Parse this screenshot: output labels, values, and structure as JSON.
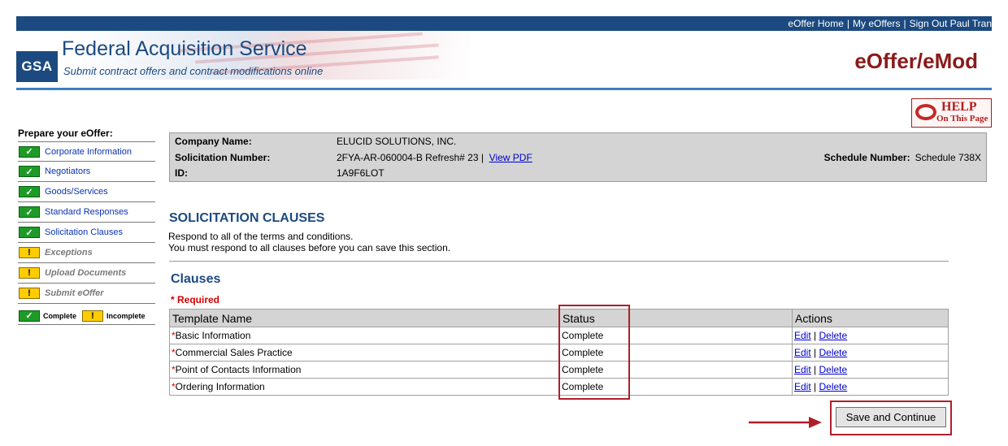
{
  "topnav": {
    "home": "eOffer Home",
    "myoffers": "My eOffers",
    "signout": "Sign Out Paul Tran",
    "sep": "|"
  },
  "header": {
    "logo": "GSA",
    "title": "Federal Acquisition Service",
    "subtitle": "Submit contract offers and contract modifications online",
    "brand": "eOffer/eMod"
  },
  "help": {
    "line1": "HELP",
    "line2": "On This Page"
  },
  "leftnav": {
    "title": "Prepare your eOffer:",
    "items": [
      {
        "label": "Corporate Information",
        "status": "complete"
      },
      {
        "label": "Negotiators",
        "status": "complete"
      },
      {
        "label": "Goods/Services",
        "status": "complete"
      },
      {
        "label": "Standard Responses",
        "status": "complete"
      },
      {
        "label": "Solicitation Clauses",
        "status": "complete"
      },
      {
        "label": "Exceptions",
        "status": "incomplete"
      },
      {
        "label": "Upload Documents",
        "status": "incomplete"
      },
      {
        "label": "Submit eOffer",
        "status": "incomplete"
      }
    ],
    "legend_complete": "Complete",
    "legend_incomplete": "Incomplete",
    "check_glyph": "✓",
    "warn_glyph": "!"
  },
  "info": {
    "company_label": "Company Name:",
    "company_value": "ELUCID SOLUTIONS, INC.",
    "solicitation_label": "Solicitation Number:",
    "solicitation_value": "2FYA-AR-060004-B Refresh# 23 |",
    "view_pdf": "View PDF",
    "id_label": "ID:",
    "id_value": "1A9F6LOT",
    "schedule_label": "Schedule Number:",
    "schedule_value": "Schedule 738X"
  },
  "section": {
    "title": "SOLICITATION CLAUSES",
    "desc1": "Respond to all of the terms and conditions.",
    "desc2": "You must respond to all clauses before you can save this section.",
    "clauses_title": "Clauses",
    "required": "* Required"
  },
  "table": {
    "headers": [
      "Template Name",
      "Status",
      "Actions"
    ],
    "rows": [
      {
        "name": "Basic Information",
        "status": "Complete",
        "edit": "Edit",
        "delete": "Delete"
      },
      {
        "name": "Commercial Sales Practice",
        "status": "Complete",
        "edit": "Edit",
        "delete": "Delete"
      },
      {
        "name": "Point of Contacts Information",
        "status": "Complete",
        "edit": "Edit",
        "delete": "Delete"
      },
      {
        "name": "Ordering Information",
        "status": "Complete",
        "edit": "Edit",
        "delete": "Delete"
      }
    ],
    "star": "*",
    "pipe": "|"
  },
  "save_button": "Save and Continue",
  "colors": {
    "navy": "#1c4a80",
    "accent_red": "#b01e2a",
    "check_green": "#1e9b26",
    "warn_yellow": "#ffcc00"
  }
}
